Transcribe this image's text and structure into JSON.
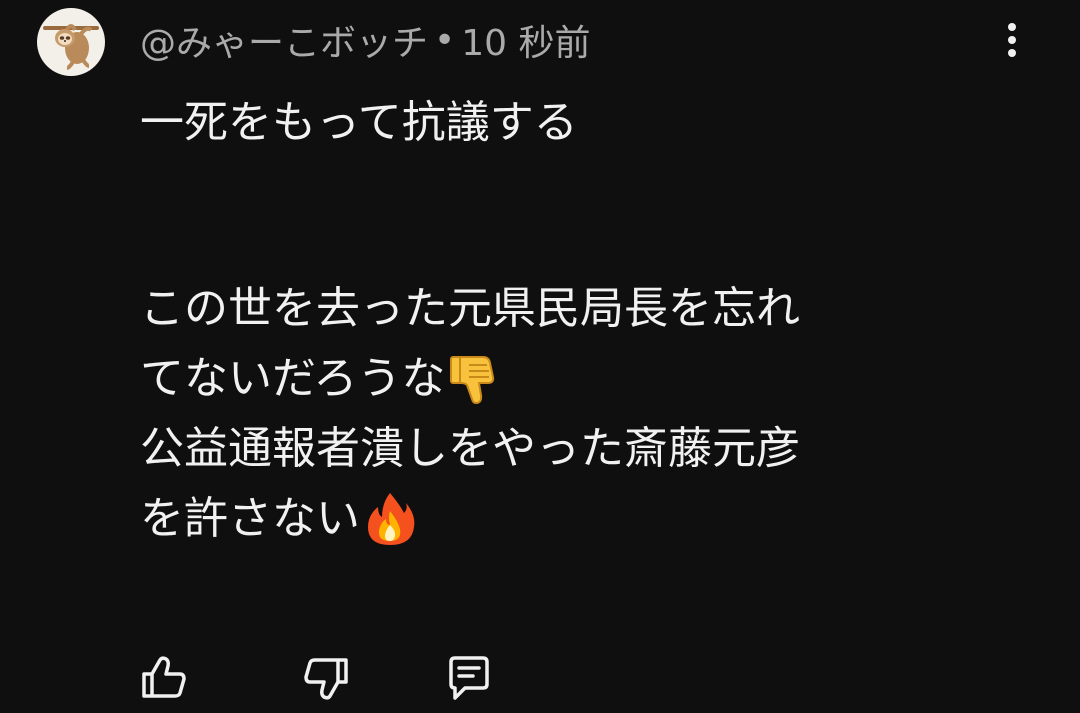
{
  "comment": {
    "author": "@みゃーこボッチ",
    "separator": "•",
    "time": "10 秒前",
    "avatar_icon": "sloth-avatar",
    "lines": [
      "一死をもって抗議する",
      "この世を去った元県民局長を忘れ",
      "てないだろうな",
      "公益通報者潰しをやった斎藤元彦",
      "を許さない"
    ],
    "emojis": [
      "thumbs-down-emoji",
      "fire-emoji"
    ]
  },
  "actions": {
    "like_icon": "thumbs-up-icon",
    "dislike_icon": "thumbs-down-icon",
    "reply_icon": "comment-icon",
    "menu_icon": "more-vert-icon"
  },
  "colors": {
    "background": "#0f0f0f",
    "text": "#f1f1f1",
    "secondary_text": "#aaaaaa"
  }
}
